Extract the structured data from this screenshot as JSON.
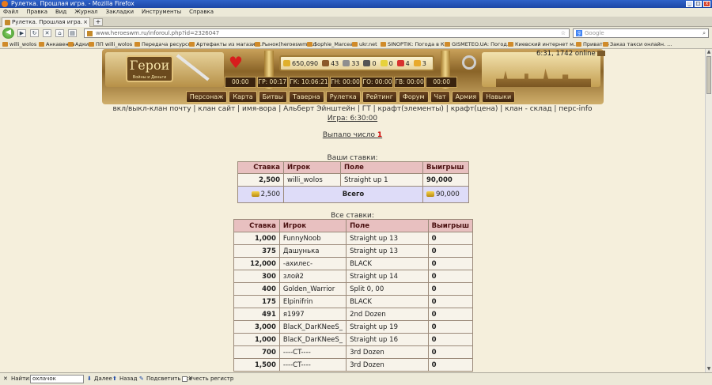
{
  "window": {
    "title": "Рулетка. Прошлая игра. - Mozilla Firefox"
  },
  "menu": [
    "Файл",
    "Правка",
    "Вид",
    "Журнал",
    "Закладки",
    "Инструменты",
    "Справка"
  ],
  "tab": {
    "title": "Рулетка. Прошлая игра."
  },
  "address": {
    "url": "www.heroeswm.ru/inforoul.php?id=2326047"
  },
  "search": {
    "placeholder": "Google"
  },
  "bookmarks": [
    "willi_wolos",
    "Анкавента",
    "Адкин",
    "ПП willi_wolos",
    "Передача ресурсов",
    "Артефакты из магазин...",
    "Рынок(heroeswm.ru)",
    "Sophie_Marceau",
    "ukr.net",
    "SINOPTIK: Погода в К...",
    "GISMETEO.UA: Погод...",
    "Киевский интернет м...",
    "Приват24",
    "Заказ такси онлайн. ..."
  ],
  "header": {
    "online": "6:31, 1742 online",
    "logo": "Герои",
    "logo_sub": "Войны и Деньги",
    "resources": [
      "650,090",
      "43",
      "33",
      "0",
      "0",
      "4",
      "3"
    ],
    "timers": [
      "00:00",
      "ГР: 00:17",
      "ГК: 10:06:21",
      "ГН: 00:00",
      "ГО: 00:00",
      "ГВ: 00:00",
      "00:00"
    ],
    "nav": [
      "Персонаж",
      "Карта",
      "Битвы",
      "Таверна",
      "Рулетка",
      "Рейтинг",
      "Форум",
      "Чат",
      "Армия",
      "Навыки"
    ]
  },
  "links": "вкл/выкл-клан почту | клан сайт | имя-вора | Альберт Эйнштейн | ГТ | крафт(элементы) | крафт(цена) | клан - склад | перс-info",
  "game_link": "Игра: 6:30:00",
  "dropped": {
    "label": "Выпало число",
    "number": "1"
  },
  "your_bets": {
    "caption": "Ваши ставки:",
    "headers": [
      "Ставка",
      "Игрок",
      "Поле",
      "Выигрыш"
    ],
    "row": {
      "stake": "2,500",
      "player": "willi_wolos",
      "field": "Straight up 1",
      "win": "90,000"
    },
    "total": {
      "stake": "2,500",
      "label": "Всего",
      "win": "90,000"
    }
  },
  "all_bets": {
    "caption": "Все ставки:",
    "headers": [
      "Ставка",
      "Игрок",
      "Поле",
      "Выигрыш"
    ],
    "rows": [
      {
        "stake": "1,000",
        "player": "FunnyNoob",
        "field": "Straight up 13",
        "win": "0"
      },
      {
        "stake": "375",
        "player": "Дашунька",
        "field": "Straight up 13",
        "win": "0"
      },
      {
        "stake": "12,000",
        "player": "-ахилес-",
        "field": "BLACK",
        "win": "0"
      },
      {
        "stake": "300",
        "player": "злой2",
        "field": "Straight up 14",
        "win": "0"
      },
      {
        "stake": "400",
        "player": "Golden_Warrior",
        "field": "Split 0, 00",
        "win": "0"
      },
      {
        "stake": "175",
        "player": "Elpinifrin",
        "field": "BLACK",
        "win": "0"
      },
      {
        "stake": "491",
        "player": "я1997",
        "field": "2nd Dozen",
        "win": "0"
      },
      {
        "stake": "3,000",
        "player": "BlacK_DarKNeeS_",
        "field": "Straight up 19",
        "win": "0"
      },
      {
        "stake": "1,000",
        "player": "BlacK_DarKNeeS_",
        "field": "Straight up 16",
        "win": "0"
      },
      {
        "stake": "700",
        "player": "----CT----",
        "field": "3rd Dozen",
        "win": "0"
      },
      {
        "stake": "1,500",
        "player": "----CT----",
        "field": "3rd Dozen",
        "win": "0"
      }
    ]
  },
  "findbar": {
    "label": "Найти:",
    "value": "охлачок",
    "next": "Далее",
    "prev": "Назад",
    "highlight": "Подсветить все",
    "match_case": "Учесть регистр"
  }
}
